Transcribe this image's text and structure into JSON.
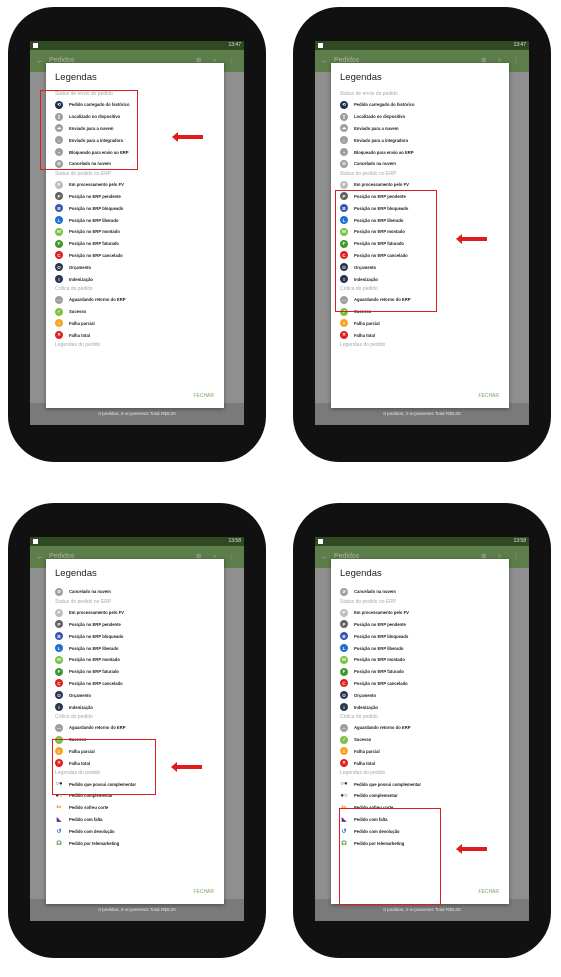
{
  "app": {
    "title": "Pedidos",
    "dialog_title": "Legendas",
    "close_label": "FECHAR",
    "totals": "0 pedidos, 0 orçamentos   Total R$0,00",
    "back_icon": "←",
    "actions_icons": "⊞ ⌕ ⋮"
  },
  "phones": [
    {
      "time": "13:47"
    },
    {
      "time": "13:47"
    },
    {
      "time": "13:58"
    },
    {
      "time": "13:58"
    }
  ],
  "sections": {
    "envio": "Status de envio do pedido",
    "erp": "Status do pedido no ERP",
    "critica": "Crítica do pedido",
    "legendas": "Legendas do pedido"
  },
  "envio_items": [
    {
      "label": "Pedido carregado do histórico",
      "icon": "history-icon",
      "color": "#1b2f4e",
      "glyph": "⟲"
    },
    {
      "label": "Localizado no dispositivo",
      "icon": "device-icon",
      "color": "#9e9e9e",
      "glyph": "▯"
    },
    {
      "label": "Enviado para a nuvem",
      "icon": "cloud-icon",
      "color": "#9e9e9e",
      "glyph": "☁"
    },
    {
      "label": "Enviado para a integradora",
      "icon": "integrator-icon",
      "color": "#9e9e9e",
      "glyph": "⌂"
    },
    {
      "label": "Bloqueado para envio ao ERP",
      "icon": "lock-icon",
      "color": "#9e9e9e",
      "glyph": "▪"
    },
    {
      "label": "Cancelado na nuvem",
      "icon": "cancel-cloud-icon",
      "color": "#9e9e9e",
      "glyph": "⊘"
    }
  ],
  "erp_items": [
    {
      "label": "Em processamento pelo FV",
      "letter": "P",
      "color": "#bdbdbd"
    },
    {
      "label": "Posição no ERP pendente",
      "letter": "P",
      "color": "#616161"
    },
    {
      "label": "Posição no ERP bloqueado",
      "letter": "B",
      "color": "#3a57b0"
    },
    {
      "label": "Posição no ERP liberado",
      "letter": "L",
      "color": "#1f6fd1"
    },
    {
      "label": "Posição no ERP montado",
      "letter": "M",
      "color": "#7cc242"
    },
    {
      "label": "Posição no ERP faturado",
      "letter": "F",
      "color": "#3f9a2e"
    },
    {
      "label": "Posição no ERP cancelado",
      "letter": "C",
      "color": "#e02020"
    },
    {
      "label": "Orçamento",
      "letter": "O",
      "color": "#2a3550"
    },
    {
      "label": "Indenização",
      "letter": "I",
      "color": "#2a3550"
    }
  ],
  "critica_items": [
    {
      "label": "Aguardando retorno do ERP",
      "icon": "waiting-icon",
      "color": "#9e9e9e",
      "glyph": "…"
    },
    {
      "label": "Sucesso",
      "icon": "check-icon",
      "color": "#7cc242",
      "glyph": "✓"
    },
    {
      "label": "Falha parcial",
      "icon": "partial-fail-icon",
      "color": "#f5a623",
      "glyph": "!"
    },
    {
      "label": "Falha total",
      "icon": "total-fail-icon",
      "color": "#e02020",
      "glyph": "✕"
    }
  ],
  "legendas_items": [
    {
      "label": "Pedido que possui complementar",
      "icon": "complement-owner-icon",
      "glyph": "○●",
      "tone": ""
    },
    {
      "label": "Pedido complementar",
      "icon": "complement-icon",
      "glyph": "●○",
      "tone": ""
    },
    {
      "label": "Pedido sofreu corte",
      "icon": "scissors-icon",
      "glyph": "✂",
      "tone": "orange"
    },
    {
      "label": "Pedido com falta",
      "icon": "shortage-icon",
      "glyph": "◣",
      "tone": "purple"
    },
    {
      "label": "Pedido com devolução",
      "icon": "return-icon",
      "glyph": "↺",
      "tone": "blue"
    },
    {
      "label": "Pedido por telemarketing",
      "icon": "headset-icon",
      "glyph": "☊",
      "tone": "green"
    }
  ],
  "colors": {
    "highlight": "#e01b1b",
    "accent": "#7da85a",
    "appbar": "#5d7d4a"
  }
}
